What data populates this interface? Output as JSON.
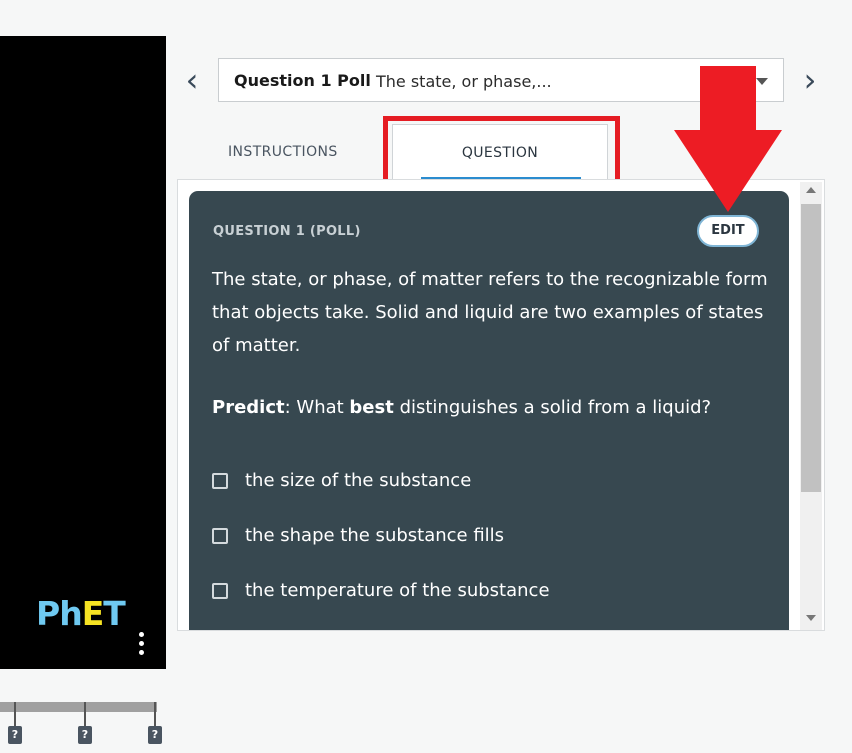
{
  "nav": {
    "prev_icon": "chevron-left-icon",
    "next_icon": "chevron-right-icon",
    "prev_glyph": "‹",
    "next_glyph": "›"
  },
  "dropdown": {
    "title": "Question 1 Poll",
    "text": "The state, or phase,...",
    "caret_icon": "caret-down-icon"
  },
  "tabs": [
    {
      "label": "INSTRUCTIONS",
      "active": false
    },
    {
      "label": "QUESTION",
      "active": true
    }
  ],
  "question": {
    "label": "QUESTION 1 (POLL)",
    "edit_label": "EDIT",
    "body": "The state, or phase, of matter refers to the recognizable form that objects take. Solid and liquid are two examples of states of matter.",
    "predict_label": "Predict",
    "predict_pre": ": What ",
    "predict_bold": "best",
    "predict_post": " distinguishes a solid from a liquid?",
    "options": [
      "the size of the substance",
      "the shape the substance fills",
      "the temperature of the substance"
    ]
  },
  "sim": {
    "logo_p": "P",
    "logo_h": "h",
    "logo_e": "E",
    "logo_t": "T",
    "timeline_marks": [
      "?",
      "?",
      "?"
    ]
  },
  "colors": {
    "card_bg": "#374850",
    "accent_underline": "#2b8ccf",
    "annotation_red": "#e51c23"
  }
}
